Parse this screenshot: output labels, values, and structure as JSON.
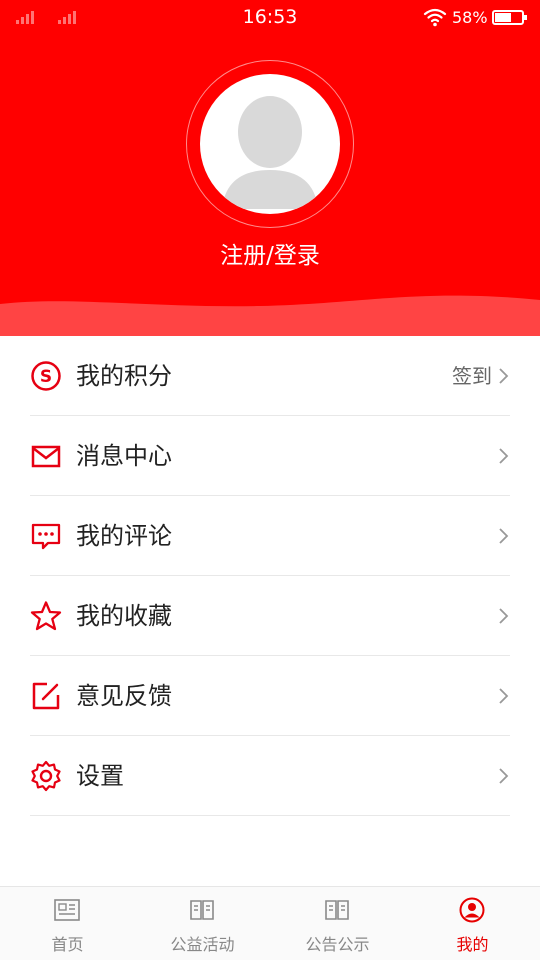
{
  "status_bar": {
    "time": "16:53",
    "battery": "58%"
  },
  "header": {
    "login_text": "注册/登录"
  },
  "menu": [
    {
      "label": "我的积分",
      "icon": "points-icon",
      "extra": "签到"
    },
    {
      "label": "消息中心",
      "icon": "mail-icon",
      "extra": ""
    },
    {
      "label": "我的评论",
      "icon": "comment-icon",
      "extra": ""
    },
    {
      "label": "我的收藏",
      "icon": "star-icon",
      "extra": ""
    },
    {
      "label": "意见反馈",
      "icon": "feedback-icon",
      "extra": ""
    },
    {
      "label": "设置",
      "icon": "gear-icon",
      "extra": ""
    }
  ],
  "tabs": [
    {
      "label": "首页",
      "icon": "news-icon",
      "active": false
    },
    {
      "label": "公益活动",
      "icon": "book-icon",
      "active": false
    },
    {
      "label": "公告公示",
      "icon": "book-icon",
      "active": false
    },
    {
      "label": "我的",
      "icon": "user-icon",
      "active": true
    }
  ],
  "colors": {
    "primary": "#ff0000",
    "accent": "#e60000"
  }
}
